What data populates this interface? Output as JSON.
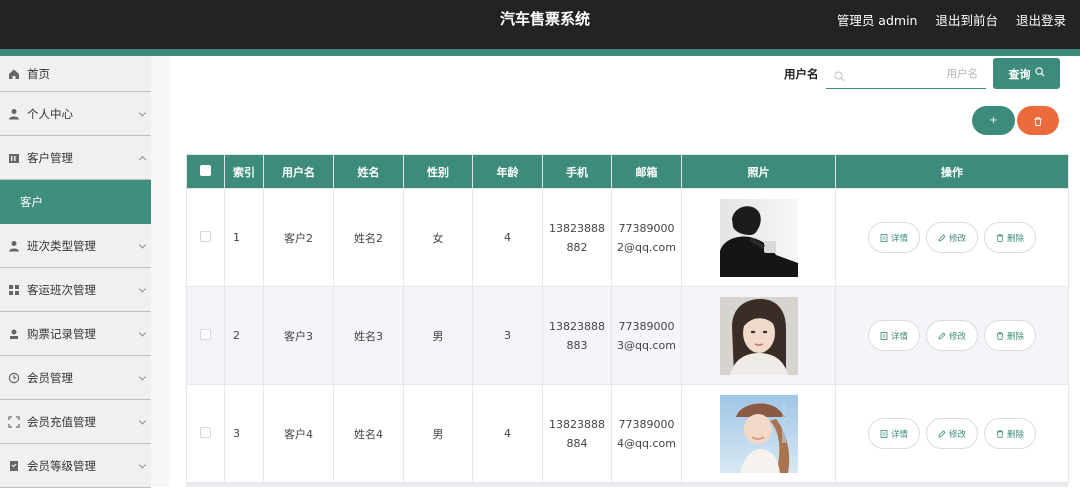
{
  "header": {
    "app_title": "汽车售票系统",
    "user_label": "管理员 admin",
    "frontend_link": "退出到前台",
    "logout_link": "退出登录"
  },
  "sidebar": {
    "items": [
      {
        "label": "首页",
        "icon": "home-icon"
      },
      {
        "label": "个人中心",
        "icon": "user-icon"
      },
      {
        "label": "客户管理",
        "icon": "customer-icon",
        "expanded": true
      },
      {
        "label": "客户",
        "sub": true,
        "active": true
      },
      {
        "label": "班次类型管理",
        "icon": "user-icon"
      },
      {
        "label": "客运班次管理",
        "icon": "grid-icon"
      },
      {
        "label": "购票记录管理",
        "icon": "ticket-icon"
      },
      {
        "label": "会员管理",
        "icon": "clock-icon"
      },
      {
        "label": "会员充值管理",
        "icon": "scan-icon"
      },
      {
        "label": "会员等级管理",
        "icon": "badge-icon"
      }
    ]
  },
  "search": {
    "label": "用户名",
    "placeholder": "用户名",
    "value": "",
    "button_label": "查询"
  },
  "toolbar": {
    "add_label": "+"
  },
  "table": {
    "columns": [
      "索引",
      "用户名",
      "姓名",
      "性别",
      "年龄",
      "手机",
      "邮箱",
      "照片",
      "操作"
    ],
    "rows": [
      {
        "index": "1",
        "username": "客户2",
        "name": "姓名2",
        "gender": "女",
        "age": "4",
        "phone_a": "13823888",
        "phone_b": "882",
        "email_a": "77389000",
        "email_b": "2@qq.com",
        "photo": "man-in-black-photo"
      },
      {
        "index": "2",
        "username": "客户3",
        "name": "姓名3",
        "gender": "男",
        "age": "3",
        "phone_a": "13823888",
        "phone_b": "883",
        "email_a": "77389000",
        "email_b": "3@qq.com",
        "photo": "woman-portrait-photo"
      },
      {
        "index": "3",
        "username": "客户4",
        "name": "姓名4",
        "gender": "男",
        "age": "4",
        "phone_a": "13823888",
        "phone_b": "884",
        "email_a": "77389000",
        "email_b": "4@qq.com",
        "photo": "woman-with-cap-photo"
      }
    ],
    "actions": {
      "detail": "详情",
      "edit": "修改",
      "delete": "删除"
    }
  },
  "colors": {
    "accent": "#3d8c7b",
    "danger": "#ec6b3c",
    "topbar": "#232323"
  }
}
